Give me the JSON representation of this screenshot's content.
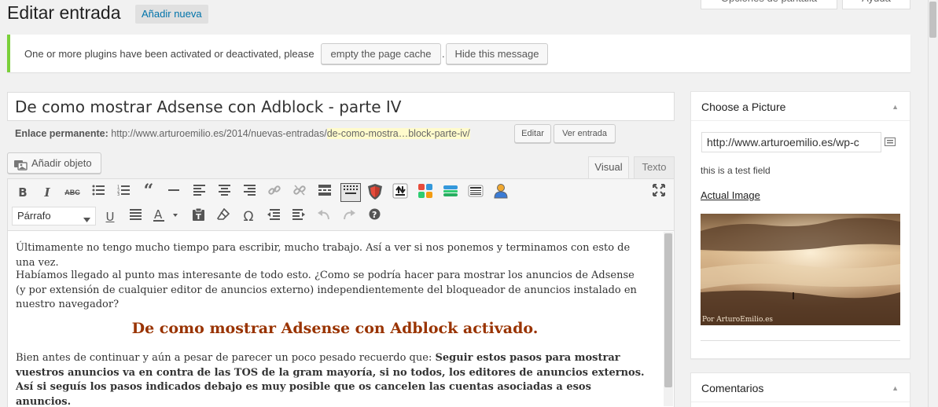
{
  "header": {
    "title": "Editar entrada",
    "add_new": "Añadir nueva",
    "screen_options": "Opciones de pantalla",
    "help": "Ayuda"
  },
  "notice": {
    "text": "One or more plugins have been activated or deactivated, please",
    "empty_cache_button": "empty the page cache",
    "separator": ".",
    "hide_button": "Hide this message",
    "accent_color": "#7ad03a"
  },
  "post": {
    "title": "De como mostrar Adsense con Adblock - parte IV",
    "permalink_label": "Enlace permanente:",
    "permalink_base": "http://www.arturoemilio.es/2014/nuevas-entradas/",
    "permalink_slug": "de-como-mostra…block-parte-iv/",
    "edit_button": "Editar",
    "view_button": "Ver entrada"
  },
  "editor": {
    "add_object_button": "Añadir objeto",
    "tabs": [
      {
        "label": "Visual",
        "active": true
      },
      {
        "label": "Texto",
        "active": false
      }
    ],
    "format_select": "Párrafo",
    "row1_icons": [
      "bold-icon",
      "italic-icon",
      "strikethrough-icon",
      "bullet-list-icon",
      "numbered-list-icon",
      "blockquote-icon",
      "horizontal-rule-icon",
      "align-left-icon",
      "align-center-icon",
      "align-right-icon",
      "link-icon",
      "unlink-icon",
      "read-more-icon",
      "toolbar-toggle-icon",
      "adblock-shield-icon",
      "upload-icon",
      "plugin-grid-icon",
      "plugin-bars-icon",
      "plugin-table-icon",
      "user-icon",
      "fullscreen-icon"
    ],
    "row2_icons": [
      "underline-icon",
      "justify-icon",
      "text-color-icon",
      "paste-text-icon",
      "clear-formatting-icon",
      "special-character-icon",
      "outdent-icon",
      "indent-icon",
      "undo-icon",
      "redo-icon",
      "help-icon"
    ],
    "content": {
      "p1": "Últimamente no tengo mucho tiempo para escribir, mucho trabajo. Así a ver si nos ponemos y terminamos con esto de una vez.",
      "p2": "Habíamos llegado al punto mas interesante de todo esto. ¿Como se podría hacer para mostrar los anuncios de Adsense (y por extensión de cualquier editor de anuncios externo) independientemente del bloqueador de anuncios instalado en nuestro navegador?",
      "heading": "De como mostrar Adsense con Adblock activado.",
      "p3_start": "Bien antes de continuar y aún a pesar de parecer un poco pesado recuerdo que: ",
      "p3_bold": "Seguir estos pasos para mostrar vuestros anuncios va en contra de las TOS de la gram mayoría, si no todos, los editores de anuncios externos. Así si seguís los pasos indicados debajo es muy posible que os cancelen las cuentas asociadas a esos anuncios.",
      "heading_color": "#993300"
    }
  },
  "sidebar": {
    "picture_box": {
      "title": "Choose a Picture",
      "url_value": "http://www.arturoemilio.es/wp-c",
      "field_description": "this is a test field",
      "image_link": "Actual Image",
      "watermark": "Por ArturoEmilio.es"
    },
    "comments_box": {
      "title": "Comentarios"
    }
  }
}
